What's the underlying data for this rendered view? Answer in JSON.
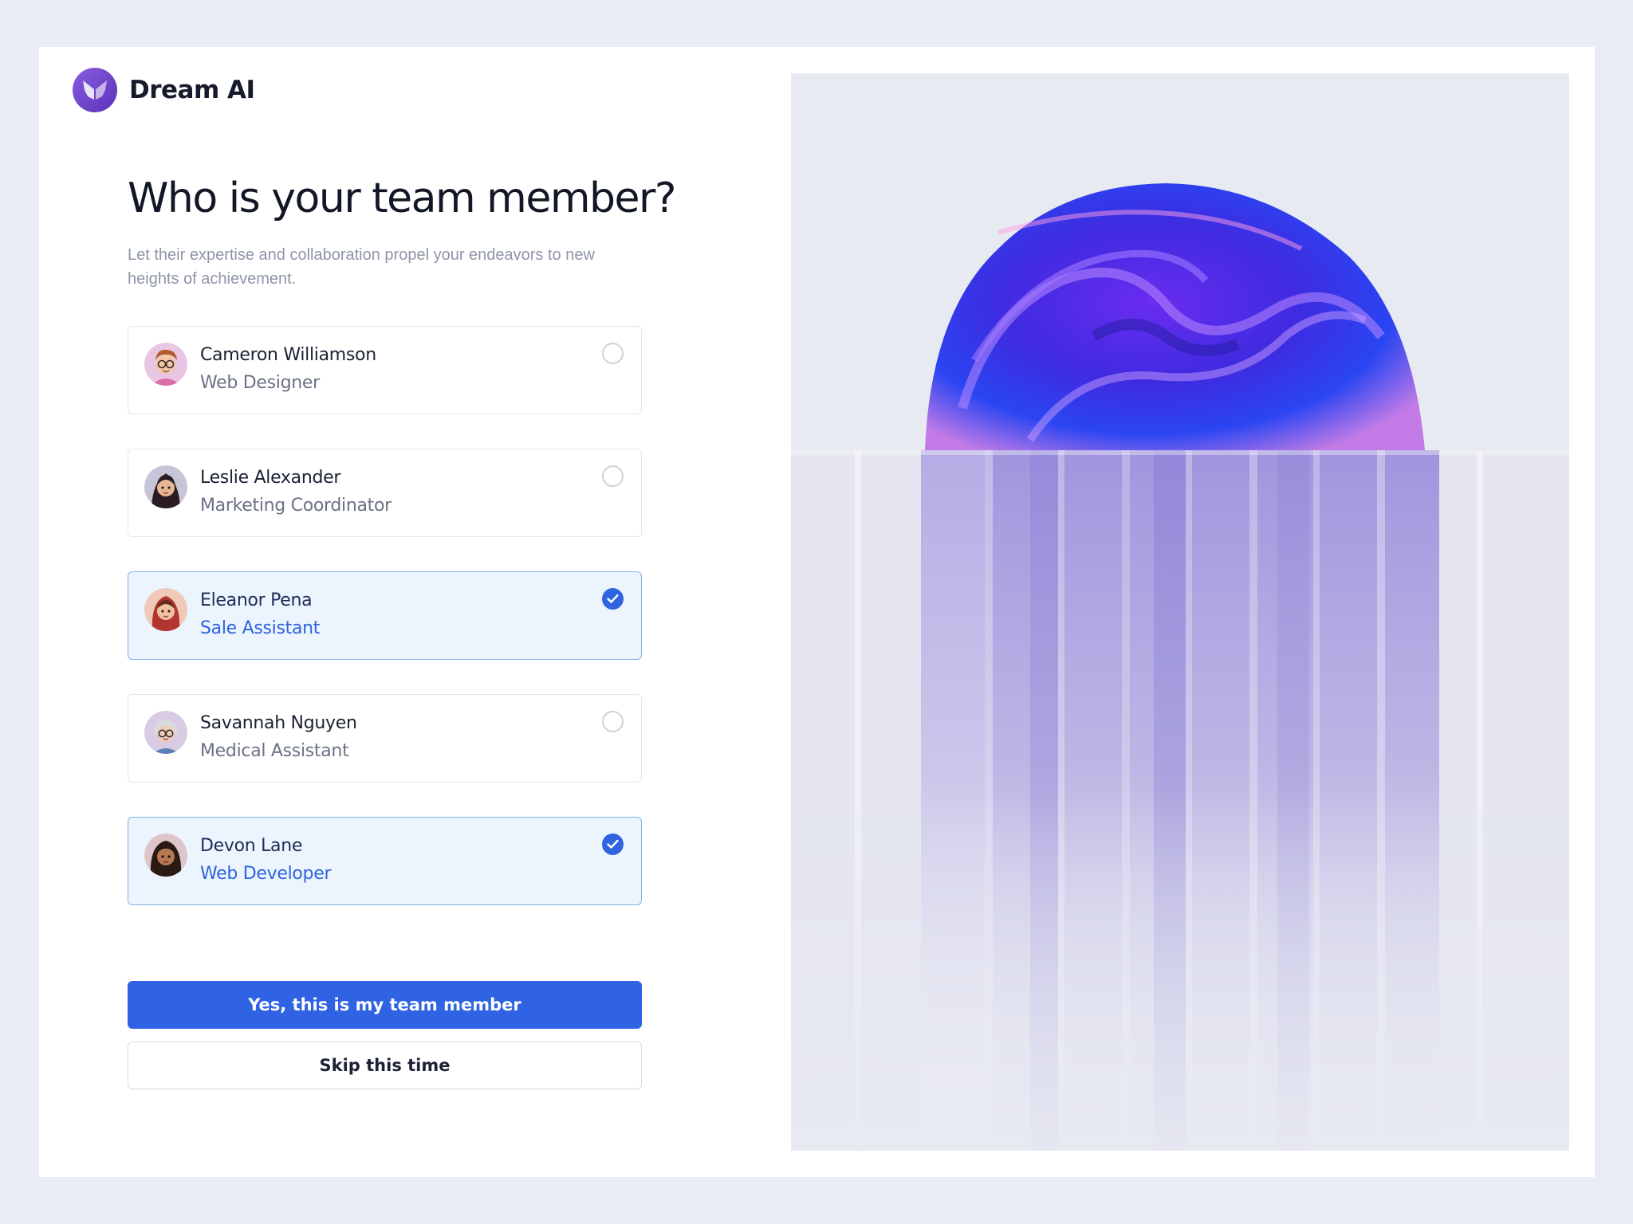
{
  "brand": {
    "name": "Dream AI"
  },
  "heading": {
    "title": "Who is your team member?",
    "subtitle": "Let their expertise and collaboration propel your endeavors to new heights of achievement."
  },
  "members": [
    {
      "name": "Cameron Williamson",
      "role": "Web Designer",
      "selected": false
    },
    {
      "name": "Leslie Alexander",
      "role": "Marketing Coordinator",
      "selected": false
    },
    {
      "name": "Eleanor Pena",
      "role": "Sale Assistant",
      "selected": true
    },
    {
      "name": "Savannah Nguyen",
      "role": "Medical Assistant",
      "selected": false
    },
    {
      "name": "Devon Lane",
      "role": "Web Developer",
      "selected": true
    }
  ],
  "actions": {
    "confirm_label": "Yes, this is my team member",
    "skip_label": "Skip this time"
  },
  "colors": {
    "accent": "#2f63e3",
    "selected_bg": "#ecf4fd",
    "selected_border": "#80b3ea",
    "page_bg": "#e9ecf4"
  },
  "icons": {
    "logo": "butterfly-logo-icon",
    "selected": "checkmark-icon"
  }
}
